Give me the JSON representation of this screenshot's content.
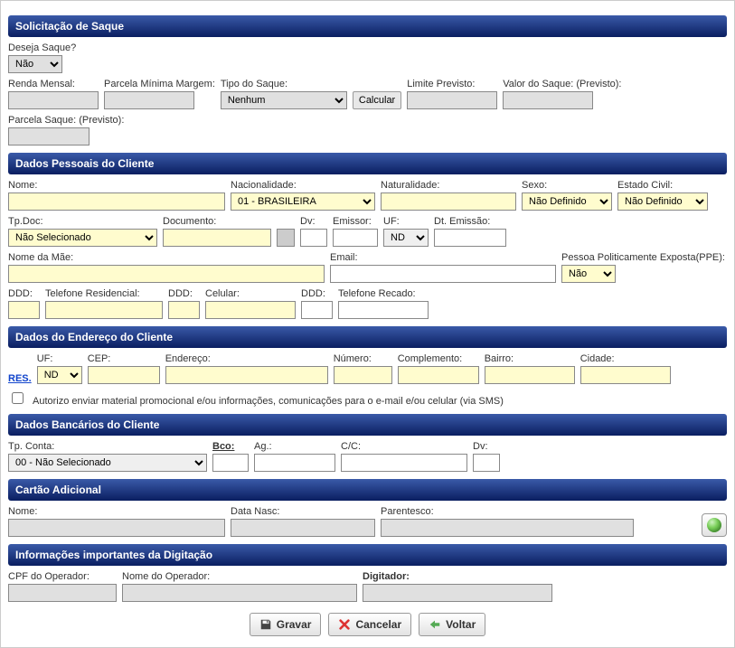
{
  "saque": {
    "header": "Solicitação de Saque",
    "deseja_label": "Deseja Saque?",
    "deseja_value": "Não",
    "renda_label": "Renda Mensal:",
    "parcela_min_label": "Parcela Mínima Margem:",
    "tipo_saque_label": "Tipo do Saque:",
    "tipo_saque_value": "Nenhum",
    "calcular": "Calcular",
    "limite_label": "Limite Previsto:",
    "valor_label": "Valor do Saque: (Previsto):",
    "parcela_label": "Parcela Saque: (Previsto):"
  },
  "pessoais": {
    "header": "Dados Pessoais do Cliente",
    "nome_label": "Nome:",
    "nacionalidade_label": "Nacionalidade:",
    "nacionalidade_value": "01 - BRASILEIRA",
    "naturalidade_label": "Naturalidade:",
    "sexo_label": "Sexo:",
    "sexo_value": "Não Definido",
    "estado_civil_label": "Estado Civil:",
    "estado_civil_value": "Não Definido",
    "tpdoc_label": "Tp.Doc:",
    "tpdoc_value": "Não Selecionado",
    "documento_label": "Documento:",
    "dv_label": "Dv:",
    "emissor_label": "Emissor:",
    "uf_label": "UF:",
    "uf_value": "ND",
    "dtemissao_label": "Dt. Emissão:",
    "nome_mae_label": "Nome da Mãe:",
    "email_label": "Email:",
    "ppe_label": "Pessoa Politicamente Exposta(PPE):",
    "ppe_value": "Não",
    "ddd_label": "DDD:",
    "tel_res_label": "Telefone Residencial:",
    "celular_label": "Celular:",
    "tel_rec_label": "Telefone Recado:"
  },
  "endereco": {
    "header": "Dados do Endereço do Cliente",
    "res_link": "RES.",
    "uf_label": "UF:",
    "uf_value": "ND",
    "cep_label": "CEP:",
    "endereco_label": "Endereço:",
    "numero_label": "Número:",
    "complemento_label": "Complemento:",
    "bairro_label": "Bairro:",
    "cidade_label": "Cidade:",
    "autorizo_label": "Autorizo enviar material promocional e/ou informações, comunicações para o e-mail e/ou celular (via SMS)"
  },
  "bancarios": {
    "header": "Dados Bancários do Cliente",
    "tpconta_label": "Tp. Conta:",
    "tpconta_value": "00 - Não Selecionado",
    "bco_label": "Bco:",
    "ag_label": "Ag.:",
    "cc_label": "C/C:",
    "dv_label": "Dv:"
  },
  "cartao": {
    "header": "Cartão Adicional",
    "nome_label": "Nome:",
    "data_nasc_label": "Data Nasc:",
    "parentesco_label": "Parentesco:"
  },
  "info": {
    "header": "Informações importantes da Digitação",
    "cpf_op_label": "CPF do Operador:",
    "nome_op_label": "Nome do Operador:",
    "digitador_label": "Digitador:"
  },
  "buttons": {
    "gravar": "Gravar",
    "cancelar": "Cancelar",
    "voltar": "Voltar"
  }
}
